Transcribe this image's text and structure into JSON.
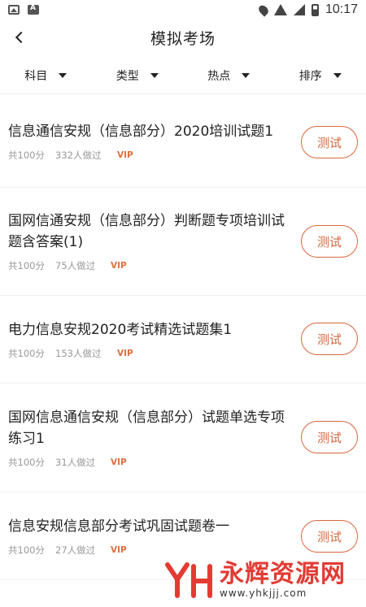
{
  "status_bar": {
    "time": "10:17"
  },
  "header": {
    "title": "模拟考场"
  },
  "filters": [
    {
      "label": "科目"
    },
    {
      "label": "类型"
    },
    {
      "label": "热点"
    },
    {
      "label": "排序"
    }
  ],
  "exams": [
    {
      "title": "信息通信安规（信息部分）2020培训试题1",
      "total": "共100分",
      "count": "332人做过",
      "vip": "VIP",
      "button": "测试"
    },
    {
      "title": "国网信通安规（信息部分）判断题专项培训试题含答案(1)",
      "total": "共100分",
      "count": "75人做过",
      "vip": "VIP",
      "button": "测试"
    },
    {
      "title": "电力信息安规2020考试精选试题集1",
      "total": "共100分",
      "count": "153人做过",
      "vip": "VIP",
      "button": "测试"
    },
    {
      "title": "国网信息通信安规（信息部分）试题单选专项练习1",
      "total": "共100分",
      "count": "31人做过",
      "vip": "VIP",
      "button": "测试"
    },
    {
      "title": "信息安规信息部分考试巩固试题卷一",
      "total": "共100分",
      "count": "27人做过",
      "vip": "VIP",
      "button": "测试"
    }
  ],
  "watermark": {
    "text": "永辉资源网",
    "url": "www.yhkjjj.com"
  },
  "colors": {
    "accent": "#d9663e",
    "vip": "#e06e3c",
    "meta": "#999999"
  }
}
